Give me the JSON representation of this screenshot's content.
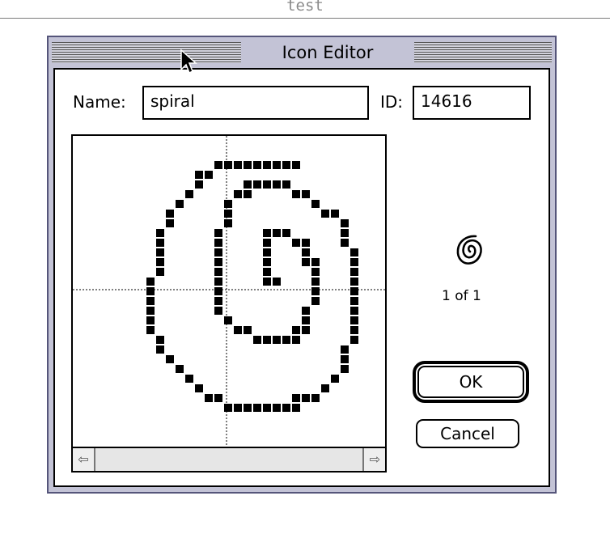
{
  "background_window": {
    "title": "test"
  },
  "dialog": {
    "title": "Icon Editor",
    "name_label": "Name:",
    "name_value": "spiral",
    "id_label": "ID:",
    "id_value": "14616",
    "preview_count": "1 of 1",
    "ok_label": "OK",
    "cancel_label": "Cancel"
  },
  "icons": {
    "scroll_left": "left-arrow-icon",
    "scroll_right": "right-arrow-icon",
    "cursor": "arrow-pointer-icon",
    "preview": "spiral-icon"
  }
}
